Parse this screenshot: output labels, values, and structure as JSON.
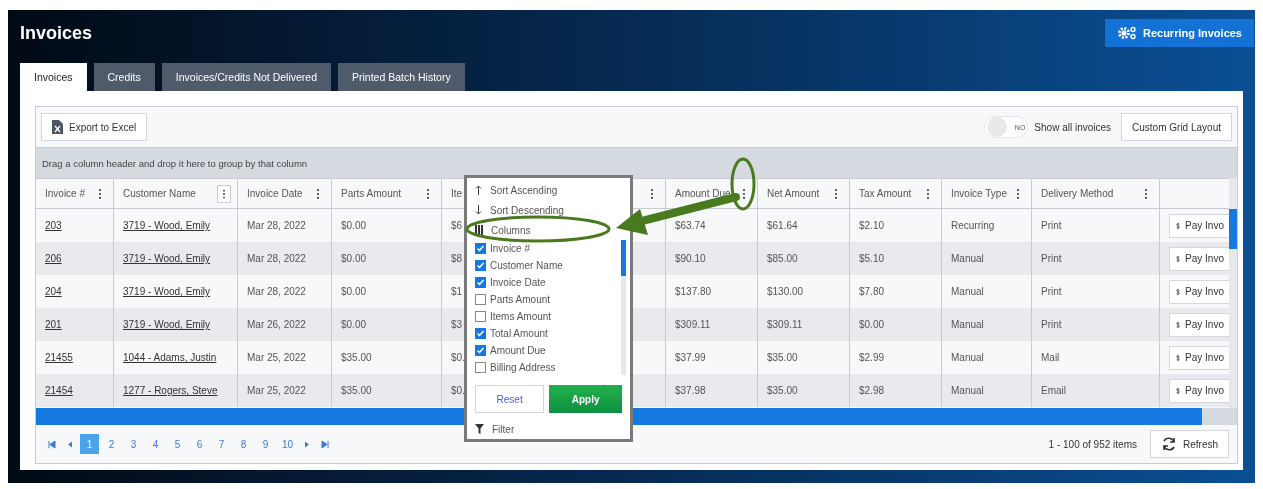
{
  "page_title": "Invoices",
  "header_button": "Recurring Invoices",
  "tabs": [
    {
      "label": "Invoices",
      "selected": true
    },
    {
      "label": "Credits",
      "selected": false
    },
    {
      "label": "Invoices/Credits Not Delivered",
      "selected": false
    },
    {
      "label": "Printed Batch History",
      "selected": false
    }
  ],
  "toolbar": {
    "export_button": "Export to Excel",
    "toggle": {
      "on": false,
      "label": "NO"
    },
    "toggle_caption": "Show all invoices",
    "layout_button": "Custom Grid Layout"
  },
  "group_hint": "Drag a column header and drop it here to group by that column",
  "table": {
    "columns": [
      {
        "label": "Invoice #",
        "menu": true,
        "hovered": false
      },
      {
        "label": "Customer Name",
        "menu": true,
        "hovered": true
      },
      {
        "label": "Invoice Date",
        "menu": true,
        "hovered": false
      },
      {
        "label": "Parts Amount",
        "menu": true,
        "hovered": false
      },
      {
        "label": "Ite"
      },
      {
        "menu": true,
        "hovered": false
      },
      {
        "label": "Amount Due",
        "menu": true,
        "hovered": false
      },
      {
        "label": "Net Amount",
        "menu": true,
        "hovered": false
      },
      {
        "label": "Tax Amount",
        "menu": true,
        "hovered": false
      },
      {
        "label": "Invoice Type",
        "menu": true,
        "hovered": false
      },
      {
        "label": "Delivery Method",
        "menu": true,
        "hovered": false
      },
      {
        "menu": false
      }
    ],
    "rows": [
      {
        "invoice": "203",
        "customer": "3719 - Wood, Emily",
        "date": "Mar 28, 2022",
        "parts": "$0.00",
        "items": "$6",
        "amount_due": "$63.74",
        "net": "$61.64",
        "tax": "$2.10",
        "type": "Recurring",
        "delivery": "Print",
        "action": "Pay Invo"
      },
      {
        "invoice": "206",
        "customer": "3719 - Wood, Emily",
        "date": "Mar 28, 2022",
        "parts": "$0.00",
        "items": "$8",
        "amount_due": "$90.10",
        "net": "$85.00",
        "tax": "$5.10",
        "type": "Manual",
        "delivery": "Print",
        "action": "Pay Invo"
      },
      {
        "invoice": "204",
        "customer": "3719 - Wood, Emily",
        "date": "Mar 28, 2022",
        "parts": "$0.00",
        "items": "$1",
        "amount_due": "$137.80",
        "net": "$130.00",
        "tax": "$7.80",
        "type": "Manual",
        "delivery": "Print",
        "action": "Pay Invo"
      },
      {
        "invoice": "201",
        "customer": "3719 - Wood, Emily",
        "date": "Mar 26, 2022",
        "parts": "$0.00",
        "items": "$3",
        "amount_due": "$309.11",
        "net": "$309.11",
        "tax": "$0.00",
        "type": "Manual",
        "delivery": "Print",
        "action": "Pay Invo"
      },
      {
        "invoice": "21455",
        "customer": "1044 - Adams, Justin",
        "date": "Mar 25, 2022",
        "parts": "$35.00",
        "items": "$0.",
        "amount_due": "$37.99",
        "net": "$35.00",
        "tax": "$2.99",
        "type": "Manual",
        "delivery": "Mail",
        "action": "Pay Invo"
      },
      {
        "invoice": "21454",
        "customer": "1277 - Rogers, Steve",
        "date": "Mar 25, 2022",
        "parts": "$35.00",
        "items": "$0.",
        "amount_due": "$37.98",
        "net": "$35.00",
        "tax": "$2.98",
        "type": "Manual",
        "delivery": "Email",
        "action": "Pay Invo"
      }
    ]
  },
  "pager": {
    "pages": [
      {
        "label": "1",
        "selected": true
      },
      {
        "label": "2",
        "selected": false
      },
      {
        "label": "3",
        "selected": false
      },
      {
        "label": "4",
        "selected": false
      },
      {
        "label": "5",
        "selected": false
      },
      {
        "label": "6",
        "selected": false
      },
      {
        "label": "7",
        "selected": false
      },
      {
        "label": "8",
        "selected": false
      },
      {
        "label": "9",
        "selected": false
      },
      {
        "label": "10",
        "selected": false
      }
    ],
    "summary": "1 - 100 of 952 items",
    "refresh_button": "Refresh"
  },
  "column_menu": {
    "items": [
      {
        "kind": "sort_up",
        "label": "Sort Ascending"
      },
      {
        "kind": "sort_down",
        "label": "Sort Descending"
      },
      {
        "kind": "columns",
        "label": "Columns"
      }
    ],
    "checklist": [
      {
        "label": "Invoice #",
        "checked": true
      },
      {
        "label": "Customer Name",
        "checked": true
      },
      {
        "label": "Invoice Date",
        "checked": true
      },
      {
        "label": "Parts Amount",
        "checked": false
      },
      {
        "label": "Items Amount",
        "checked": false
      },
      {
        "label": "Total Amount",
        "checked": true
      },
      {
        "label": "Amount Due",
        "checked": true
      },
      {
        "label": "Billing Address",
        "checked": false
      }
    ],
    "reset_button": "Reset",
    "apply_button": "Apply",
    "filter": "Filter"
  }
}
